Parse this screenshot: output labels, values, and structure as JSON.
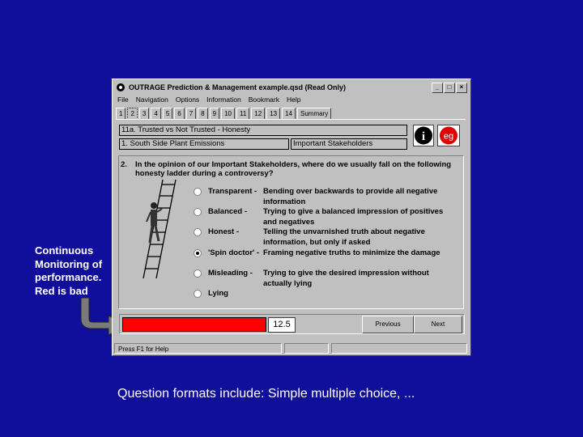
{
  "window": {
    "title": "OUTRAGE Prediction & Management   example.qsd (Read Only)",
    "buttons": [
      "_",
      "□",
      "×"
    ]
  },
  "menu": [
    "File",
    "Navigation",
    "Options",
    "Information",
    "Bookmark",
    "Help"
  ],
  "tabs": [
    "1",
    "2",
    "3",
    "4",
    "5",
    "6",
    "7",
    "8",
    "9",
    "10",
    "11",
    "12",
    "13",
    "14",
    "Summary"
  ],
  "active_tab": "2",
  "header": {
    "topic": "11a. Trusted vs Not Trusted - Honesty",
    "plant": "1. South Side Plant Emissions",
    "stakeholders": "Important Stakeholders",
    "info_icon": "i",
    "eg_icon": "eg"
  },
  "question": {
    "number": "2.",
    "text": "In the opinion of our Important Stakeholders, where do we usually fall on the following honesty ladder during a controversy?"
  },
  "options": [
    {
      "label": "Transparent -",
      "desc": "Bending over backwards to provide all negative information",
      "selected": false
    },
    {
      "label": "Balanced -",
      "desc": "Trying to give a balanced impression of positives and negatives",
      "selected": false
    },
    {
      "label": "Honest -",
      "desc": "Telling the unvarnished truth about negative information, but only if asked",
      "selected": false
    },
    {
      "label": "'Spin doctor' -",
      "desc": "Framing negative truths to minimize the damage",
      "selected": true
    },
    {
      "label": "Misleading -",
      "desc": "Trying to give the desired impression without actually lying",
      "selected": false
    },
    {
      "label": "Lying",
      "desc": "",
      "selected": false
    }
  ],
  "score": {
    "value": "12.5",
    "fraction": 0.9,
    "color": "#ff0000"
  },
  "nav": {
    "previous": "Previous",
    "next": "Next"
  },
  "status": "Press F1 for Help",
  "callout": "Continuous Monitoring of performance. Red is bad",
  "caption": "Question formats include:  Simple multiple choice, ..."
}
